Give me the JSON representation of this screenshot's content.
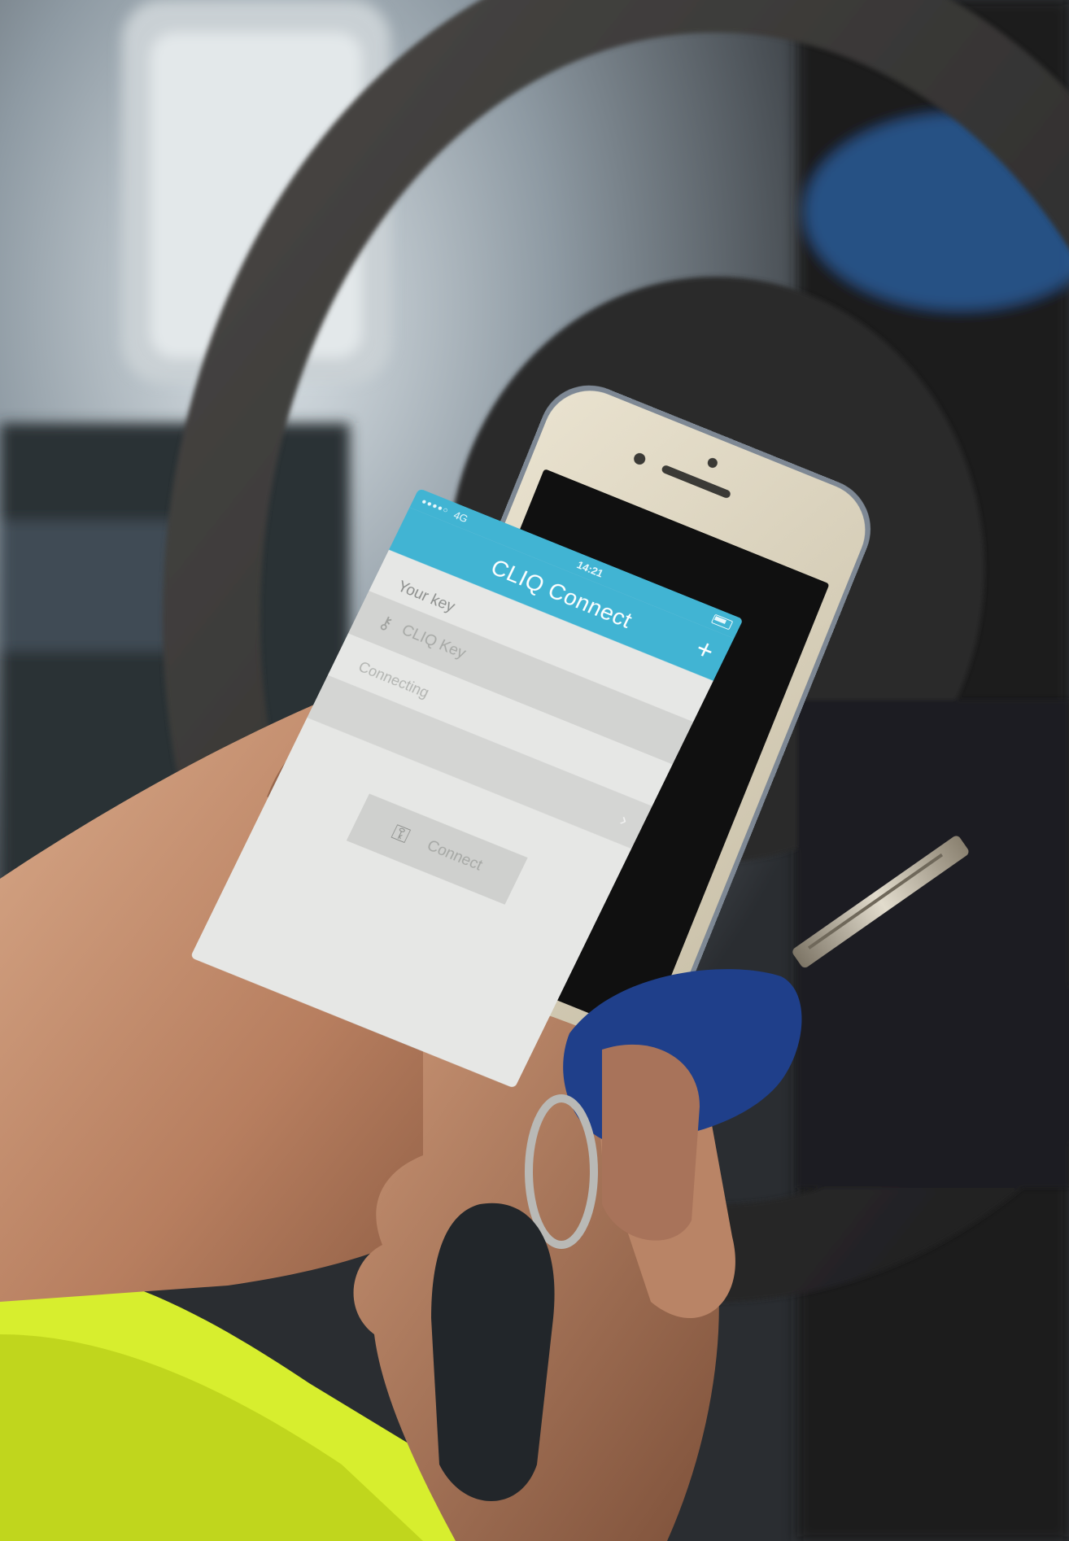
{
  "status_bar": {
    "carrier": "4G",
    "time": "14:21"
  },
  "app": {
    "title": "CLIQ Connect",
    "add_label": "+"
  },
  "key_section": {
    "label": "Your key",
    "key_name": "CLIQ Key",
    "status": "Connecting"
  },
  "connect_button": {
    "label": "Connect"
  },
  "colors": {
    "header": "#41b4d3",
    "screen_bg": "#e6e7e5",
    "keyfob": "#1f3f8a",
    "vest": "#d7ee2e"
  }
}
